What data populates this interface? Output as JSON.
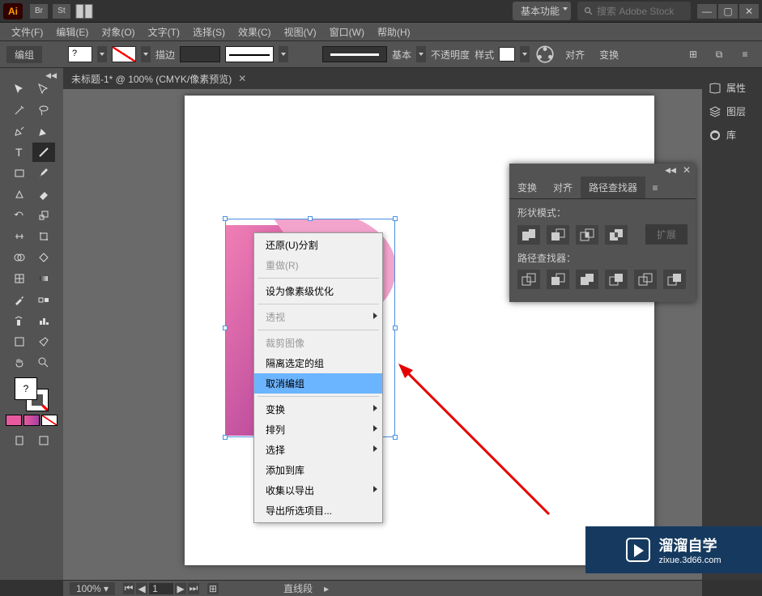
{
  "app": {
    "logo": "Ai"
  },
  "titlebar": {
    "workspace": "基本功能",
    "search_placeholder": "搜索 Adobe Stock"
  },
  "menubar": [
    "文件(F)",
    "编辑(E)",
    "对象(O)",
    "文字(T)",
    "选择(S)",
    "效果(C)",
    "视图(V)",
    "窗口(W)",
    "帮助(H)"
  ],
  "optbar": {
    "label": "编组",
    "stroke_label": "描边",
    "profile_label": "基本",
    "opacity_label": "不透明度",
    "style_label": "样式",
    "align_label": "对齐",
    "transform_label": "变换"
  },
  "document": {
    "tab_title": "未标题-1* @ 100% (CMYK/像素预览)"
  },
  "context_menu": {
    "undo": "还原(U)分割",
    "redo": "重做(R)",
    "pixel_perfect": "设为像素级优化",
    "perspective": "透视",
    "crop": "裁剪图像",
    "isolate": "隔离选定的组",
    "ungroup": "取消编组",
    "transform": "变换",
    "arrange": "排列",
    "select": "选择",
    "add_library": "添加到库",
    "collect_export": "收集以导出",
    "export_selection": "导出所选项目..."
  },
  "pathfinder": {
    "tabs": [
      "变换",
      "对齐",
      "路径查找器"
    ],
    "shape_modes": "形状模式：",
    "expand": "扩展",
    "pathfinders": "路径查找器："
  },
  "right_rail": {
    "properties": "属性",
    "layers": "图层",
    "libraries": "库"
  },
  "statusbar": {
    "zoom": "100%",
    "page": "1",
    "tool": "直线段"
  },
  "watermark": {
    "line1": "溜溜自学",
    "line2": "zixue.3d66.com"
  },
  "chart_data": null
}
